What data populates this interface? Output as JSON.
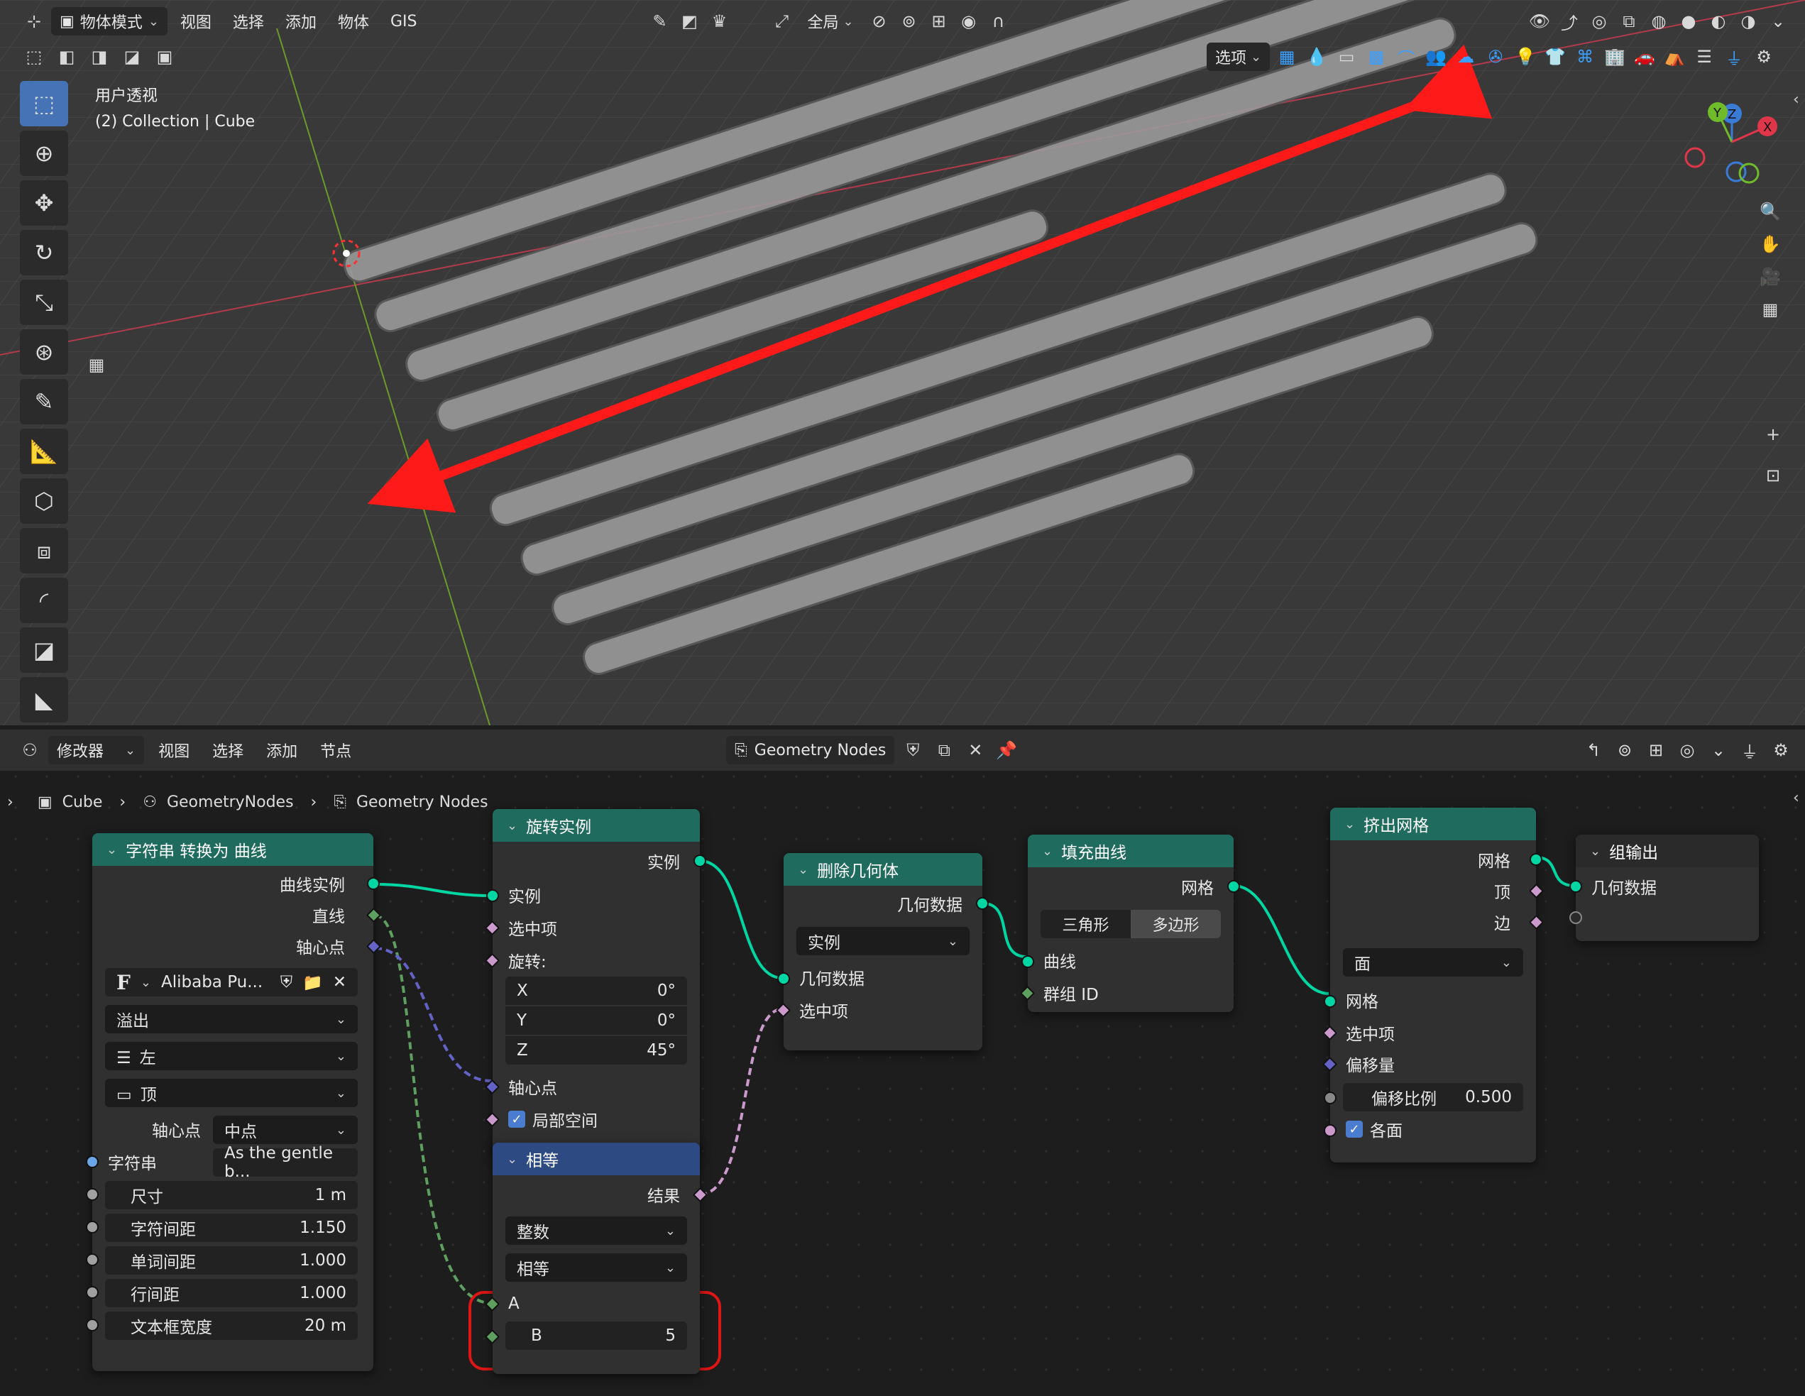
{
  "viewport": {
    "menu": [
      "物体模式",
      "视图",
      "选择",
      "添加",
      "物体",
      "GIS"
    ],
    "transform_orientation": "全局",
    "view_label": "用户透视",
    "collection_label": "(2) Collection | Cube",
    "options_label": "选项",
    "gizmo_axes": [
      "X",
      "Y",
      "Z"
    ]
  },
  "node_editor": {
    "header": {
      "editor_menu": "修改器",
      "menu": [
        "视图",
        "选择",
        "添加",
        "节点"
      ],
      "tree_name": "Geometry Nodes"
    },
    "breadcrumbs": [
      "Cube",
      "GeometryNodes",
      "Geometry Nodes"
    ],
    "nodes": {
      "string_to_curves": {
        "title": "字符串 转换为 曲线",
        "out_curve_instances": "曲线实例",
        "out_line": "直线",
        "out_pivot": "轴心点",
        "font": "Alibaba Pu...",
        "overflow": "溢出",
        "align_x": "左",
        "align_y": "顶",
        "pivot_label": "轴心点",
        "pivot_value": "中点",
        "string_label": "字符串",
        "string_value": "As the gentle b...",
        "fields": [
          {
            "label": "尺寸",
            "value": "1 m"
          },
          {
            "label": "字符间距",
            "value": "1.150"
          },
          {
            "label": "单词间距",
            "value": "1.000"
          },
          {
            "label": "行间距",
            "value": "1.000"
          },
          {
            "label": "文本框宽度",
            "value": "20 m"
          }
        ]
      },
      "rotate_instances": {
        "title": "旋转实例",
        "out_instances": "实例",
        "in_instances": "实例",
        "in_selection": "选中项",
        "rotation_label": "旋转:",
        "rotation": [
          {
            "axis": "X",
            "value": "0°"
          },
          {
            "axis": "Y",
            "value": "0°"
          },
          {
            "axis": "Z",
            "value": "45°"
          }
        ],
        "in_pivot": "轴心点",
        "local_space": "局部空间"
      },
      "compare": {
        "title": "相等",
        "out_result": "结果",
        "data_type": "整数",
        "operation": "相等",
        "in_a": "A",
        "in_b": "B",
        "b_value": "5"
      },
      "delete_geometry": {
        "title": "删除几何体",
        "out_geometry": "几何数据",
        "domain": "实例",
        "in_geometry": "几何数据",
        "in_selection": "选中项"
      },
      "fill_curve": {
        "title": "填充曲线",
        "out_mesh": "网格",
        "mode_tri": "三角形",
        "mode_ngon": "多边形",
        "in_curve": "曲线",
        "in_group": "群组 ID"
      },
      "extrude_mesh": {
        "title": "挤出网格",
        "out_mesh": "网格",
        "out_top": "顶",
        "out_side": "边",
        "mode": "面",
        "in_mesh": "网格",
        "in_selection": "选中项",
        "in_offset": "偏移量",
        "offset_scale_label": "偏移比例",
        "offset_scale_value": "0.500",
        "individual": "各面"
      },
      "group_output": {
        "title": "组输出",
        "in_geometry": "几何数据"
      }
    }
  }
}
